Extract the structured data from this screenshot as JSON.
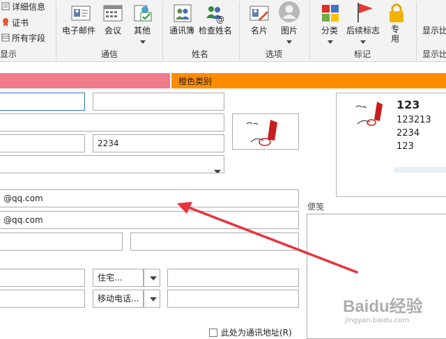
{
  "ribbon": {
    "show_group": {
      "details": "详细信息",
      "certificates": "证书",
      "all_fields": "所有字段",
      "label": "显示"
    },
    "communicate": {
      "email": "电子邮件",
      "meeting": "会议",
      "more": "其他",
      "label": "通信"
    },
    "names": {
      "address_book": "通讯簿",
      "check_names": "检查姓名",
      "label": "姓名"
    },
    "options": {
      "business_card": "名片",
      "picture": "图片",
      "label": "选项"
    },
    "tags": {
      "categorize": "分类",
      "follow_up": "后续标志",
      "private": "专用",
      "label": "标记"
    },
    "zoom": {
      "label": "显示比",
      "group_label": "显示比"
    }
  },
  "category_bar": {
    "label": "橙色类别",
    "left_color": "#ef7b8b",
    "right_color": "#ff8c00"
  },
  "form": {
    "phone_field_value": "2234",
    "email1": "@qq.com",
    "email2": "@qq.com",
    "phone_home_type": "住宅...",
    "phone_mobile_type": "移动电话...",
    "notes_label": "便笺",
    "mailing_address_label": "此处为通讯地址(R)"
  },
  "card": {
    "name": "123",
    "lines": [
      "123213",
      "2234",
      "123"
    ]
  },
  "watermark": {
    "brand": "Baidu经验",
    "url": "jingyan.baidu.com"
  },
  "colors": {
    "arrow": "#e8323c",
    "accent": "#ff8c00"
  }
}
